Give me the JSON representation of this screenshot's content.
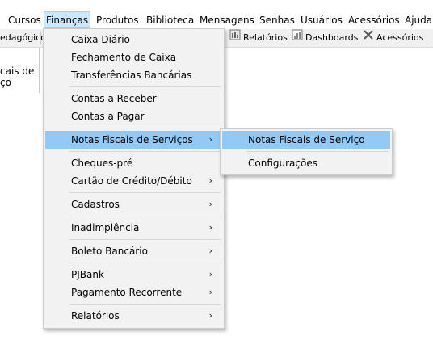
{
  "menubar": {
    "items": [
      "Cursos",
      "Finanças",
      "Produtos",
      "Biblioteca",
      "Mensagens",
      "Senhas",
      "Usuários",
      "Acessórios",
      "Ajuda"
    ],
    "active": "Finanças"
  },
  "toolbar": {
    "left_label": "edagógico",
    "items": [
      "Relatórios",
      "Dashboards",
      "Acessórios"
    ]
  },
  "left_panel": {
    "line1": "cais de",
    "line2": "ço"
  },
  "finance_menu": {
    "groups": [
      [
        "Caixa Diário",
        "Fechamento de Caixa",
        "Transferências Bancárias"
      ],
      [
        "Contas a Receber",
        "Contas a Pagar"
      ],
      [
        "Notas Fiscais de Serviços"
      ],
      [
        "Cheques-pré",
        "Cartão de Crédito/Débito"
      ],
      [
        "Cadastros"
      ],
      [
        "Inadimplência"
      ],
      [
        "Boleto Bancário"
      ],
      [
        "PJBank",
        "Pagamento Recorrente"
      ],
      [
        "Relatórios"
      ]
    ],
    "highlighted": "Notas Fiscais de Serviços",
    "submenu_arrow": "›"
  },
  "submenu": {
    "items": [
      "Notas Fiscais de Serviço",
      "Configurações"
    ],
    "highlighted": "Notas Fiscais de Serviço"
  },
  "colors": {
    "menu_bg": "#f2f2f2",
    "highlight": "#91c9f7",
    "active_menubar": "#cce8ff"
  },
  "icons": {
    "relatorios": "report-icon",
    "dashboards": "dashboard-icon",
    "acessorios": "tools-icon"
  }
}
